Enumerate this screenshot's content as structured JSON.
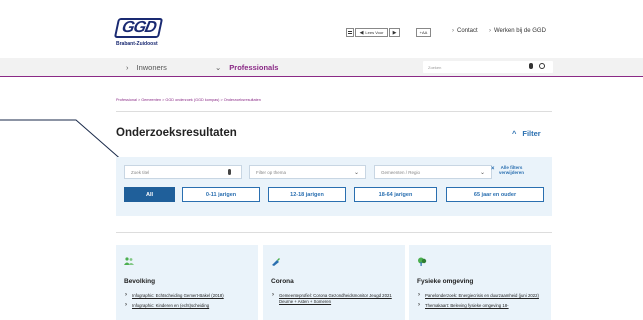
{
  "header": {
    "logo_text": "GGD",
    "logo_sub": "Brabant-Zuidoost",
    "read_aloud": "Lees Voor",
    "text_size": "+AA",
    "links": [
      "Contact",
      "Werken bij de GGD"
    ]
  },
  "nav": {
    "items": [
      {
        "label": "Inwoners",
        "icon": "chevron-right-icon"
      },
      {
        "label": "Professionals",
        "icon": "chevron-down-icon",
        "active": true
      }
    ],
    "search_placeholder": "Zoeken"
  },
  "breadcrumb": "Professional  >  Gemeenten  >  GGD onderzoek (GGD kompas)  >  Onderzoeksresultaten",
  "results": {
    "title": "Onderzoeksresultaten",
    "filter_toggle": "Filter",
    "search_title_placeholder": "Zoek titel",
    "filter_theme": "Filter op thema",
    "municipality": "Gemeenten / Regio",
    "clear_filters": [
      "Alle filters",
      "verwijderen"
    ],
    "ages": [
      "All",
      "0-11 jarigen",
      "12-18 jarigen",
      "18-64 jarigen",
      "65 jaar en ouder"
    ],
    "active_age": "All"
  },
  "cards": [
    {
      "title": "Bevolking",
      "icon": "people-icon",
      "links": [
        "Infographic: Echtscheiding Gemert-Bakel (2018)",
        "Infographic: Kinderen en (echt)scheiding"
      ]
    },
    {
      "title": "Corona",
      "icon": "syringe-icon",
      "links": [
        "Gemeenteprofiel: Corona Gezondheidsmonitor Jeugd 2021 Deurne + Asten + Someren"
      ]
    },
    {
      "title": "Fysieke omgeving",
      "icon": "tree-icon",
      "links": [
        "Panelonderzoek: Energiecrisis en duurzaamheid (juni 2022)",
        "Themakaart: Beleving fysieke omgeving 18-"
      ]
    }
  ],
  "colors": {
    "brand_purple": "#8a2a86",
    "accent_blue": "#2a6fb0",
    "panel_bg": "#eaf3fa"
  }
}
